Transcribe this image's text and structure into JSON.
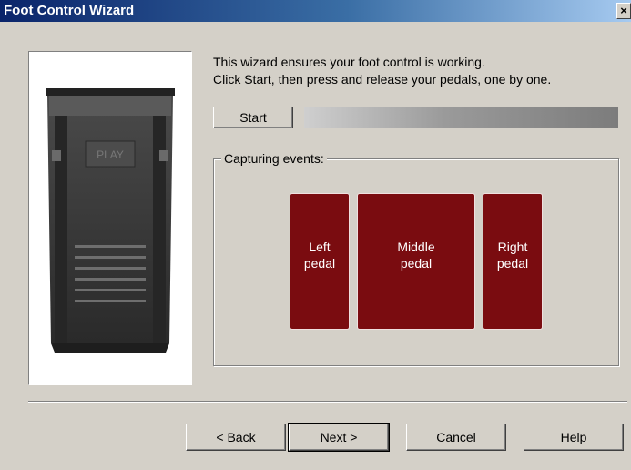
{
  "window": {
    "title": "Foot Control Wizard",
    "close_label": "×"
  },
  "image": {
    "pedal_label": "PLAY"
  },
  "instructions": {
    "line1": "This wizard ensures your foot control is working.",
    "line2": "Click Start, then press and release your pedals, one by one."
  },
  "start_button": {
    "label": "Start"
  },
  "capture_group": {
    "label": "Capturing events:",
    "pedals": [
      {
        "line1": "Left",
        "line2": "pedal"
      },
      {
        "line1": "Middle",
        "line2": "pedal"
      },
      {
        "line1": "Right",
        "line2": "pedal"
      }
    ]
  },
  "buttons": {
    "back": "< Back",
    "next": "Next >",
    "cancel": "Cancel",
    "help": "Help"
  },
  "colors": {
    "pedal_fill": "#7a0c10",
    "title_start": "#0a246a",
    "title_end": "#a6caf0"
  }
}
